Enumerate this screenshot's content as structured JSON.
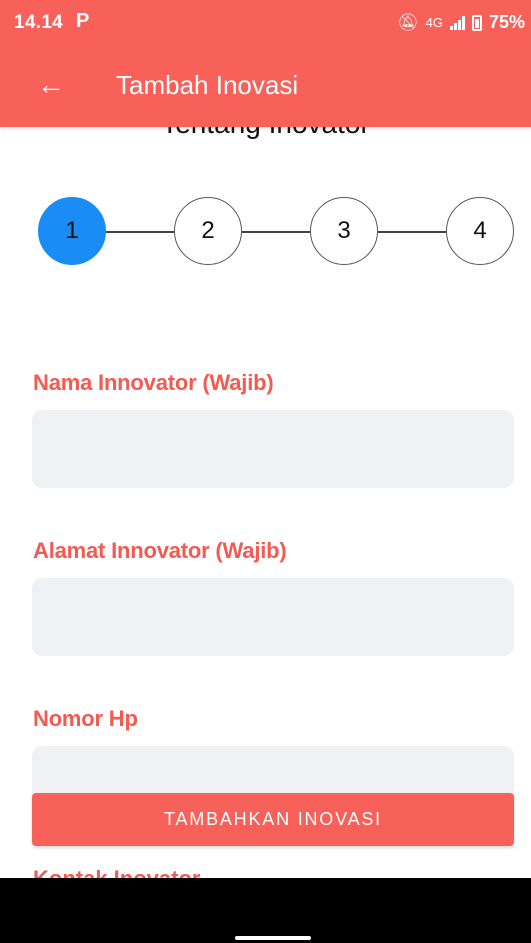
{
  "status_bar": {
    "time": "14.14",
    "notification_icon": "P",
    "network": "4G",
    "battery": "75%",
    "icons": [
      "mute-icon",
      "signal-icon",
      "battery-icon"
    ]
  },
  "app_bar": {
    "back_icon": "←",
    "title": "Tambah Inovasi",
    "color": "#f8615a"
  },
  "section_title": "Tentang Inovator",
  "stepper": {
    "steps": [
      "1",
      "2",
      "3",
      "4"
    ],
    "active_step": 1,
    "active_color": "#1a8cf5"
  },
  "form": {
    "fields": [
      {
        "label": "Nama Innovator (Wajib)",
        "value": ""
      },
      {
        "label": "Alamat Innovator (Wajib)",
        "value": ""
      },
      {
        "label": "Nomor Hp",
        "value": ""
      }
    ],
    "partially_hidden_label": "Kontak Inovator",
    "label_color": "#f25a52",
    "submit_label": "TAMBAHKAN INOVASI"
  }
}
